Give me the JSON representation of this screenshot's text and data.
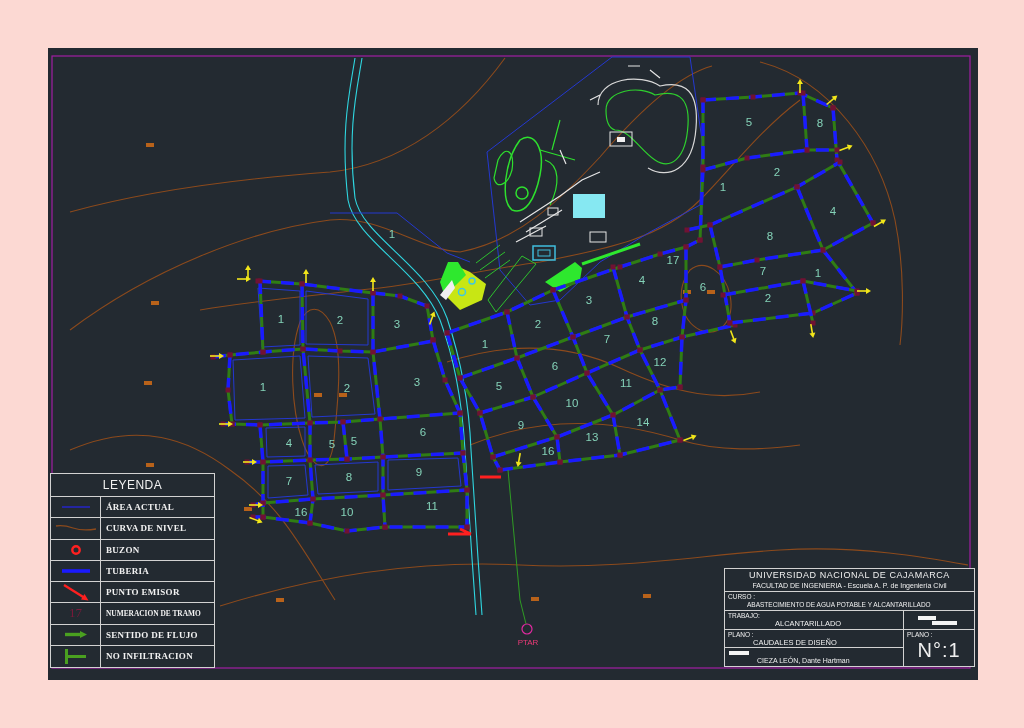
{
  "map": {
    "block_numbers": [
      "5",
      "8",
      "2",
      "1",
      "4",
      "1",
      "8",
      "17",
      "7",
      "1",
      "4",
      "6",
      "3",
      "2",
      "1",
      "2",
      "3",
      "2",
      "8",
      "1",
      "7",
      "6",
      "12",
      "1",
      "2",
      "3",
      "5",
      "11",
      "10",
      "9",
      "14",
      "4",
      "5",
      "5",
      "6",
      "13",
      "16",
      "7",
      "8",
      "9",
      "16",
      "10",
      "11"
    ],
    "plant_label": "PTAR"
  },
  "legend": {
    "title": "LEYENDA",
    "items": [
      {
        "kind": "area",
        "label": "ÁREA ACTUAL"
      },
      {
        "kind": "contour",
        "label": "CURVA DE NIVEL"
      },
      {
        "kind": "manhole",
        "label": "BUZON"
      },
      {
        "kind": "pipe",
        "label": "TUBERIA"
      },
      {
        "kind": "outfall",
        "label": "PUNTO EMISOR"
      },
      {
        "kind": "number",
        "label": "NUMERACION DE TRAMO",
        "symbol": "17"
      },
      {
        "kind": "flow",
        "label": "SENTIDO DE FLUJO"
      },
      {
        "kind": "no_infiltration",
        "label": "NO INFILTRACION"
      }
    ]
  },
  "title_block": {
    "university": "UNIVERSIDAD NACIONAL DE CAJAMARCA",
    "faculty": "FACULTAD DE INGENIERIA - Escuela A. P. de Ingeniería Civil",
    "course_label": "CURSO :",
    "course": "ABASTECIMIENTO DE AGUA POTABLE Y ALCANTARILLADO",
    "work_label": "TRABAJO:",
    "work": "ALCANTARILLADO",
    "plan_label": "PLANO :",
    "plan": "CAUDALES DE DISEÑO",
    "sheet_label": "PLANO :",
    "sheet_number": "N°:1",
    "author": "CIEZA LEÓN, Dante Hartman"
  }
}
